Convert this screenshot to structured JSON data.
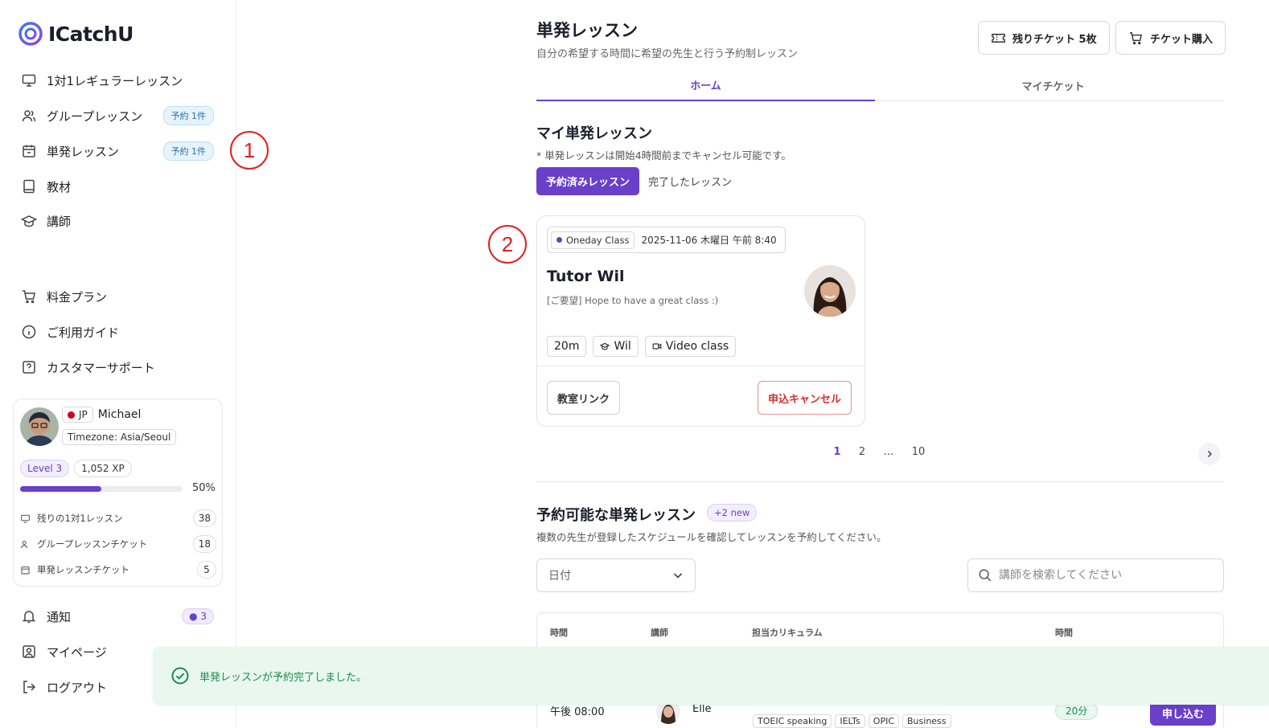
{
  "app": {
    "name": "ICatchU"
  },
  "sidebar": {
    "nav": [
      {
        "label": "1対1レギュラーレッスン",
        "icon": "monitor-icon"
      },
      {
        "label": "グループレッスン",
        "icon": "users-icon",
        "badge": "予約 1件"
      },
      {
        "label": "単発レッスン",
        "icon": "calendar-icon",
        "badge": "予約 1件"
      },
      {
        "label": "教材",
        "icon": "book-icon"
      },
      {
        "label": "講師",
        "icon": "graduation-cap-icon"
      }
    ],
    "nav2": [
      {
        "label": "料金プラン",
        "icon": "cart-icon"
      },
      {
        "label": "ご利用ガイド",
        "icon": "info-icon"
      },
      {
        "label": "カスタマーサポート",
        "icon": "help-icon"
      }
    ],
    "profile": {
      "country": "JP",
      "name": "Michael",
      "timezone": "Timezone: Asia/Seoul",
      "level": "Level 3",
      "xp": "1,052 XP",
      "progress_label": "50%",
      "progress": 0.5,
      "stats": [
        {
          "label": "残りの1対1レッスン",
          "value": "38"
        },
        {
          "label": "グループレッスンチケット",
          "value": "18"
        },
        {
          "label": "単発レッスンチケット",
          "value": "5"
        }
      ]
    },
    "bottom": [
      {
        "label": "通知",
        "icon": "bell-icon",
        "badge": "3"
      },
      {
        "label": "マイページ",
        "icon": "user-icon"
      },
      {
        "label": "ログアウト",
        "icon": "logout-icon"
      }
    ]
  },
  "header": {
    "title": "単発レッスン",
    "subtitle": "自分の希望する時間に希望の先生と行う予約制レッスン",
    "tickets_btn": "残りチケット 5枚",
    "buy_btn": "チケット購入"
  },
  "tabs": [
    {
      "label": "ホーム",
      "active": true
    },
    {
      "label": "マイチケット",
      "active": false
    }
  ],
  "my_lessons": {
    "title": "マイ単発レッスン",
    "note": "* 単発レッスンは開始4時間前までキャンセル可能です。",
    "filter_active": "予約済みレッスン",
    "filter_other": "完了したレッスン",
    "card": {
      "class_type": "Oneday Class",
      "datetime": "2025-11-06 木曜日 午前 8:40",
      "tutor": "Tutor Wil",
      "request": "[ご要望] Hope to have a great class :)",
      "duration": "20m",
      "tutor_tag": "Wil",
      "format": "Video class",
      "room_link": "教室リンク",
      "cancel": "申込キャンセル"
    },
    "pages": [
      "1",
      "2",
      "...",
      "10"
    ],
    "current_page": "1"
  },
  "available": {
    "title": "予約可能な単発レッスン",
    "new_badge": "+2 new",
    "note": "複数の先生が登録したスケジュールを確認してレッスンを予約してください。",
    "date_select": "日付",
    "search_placeholder": "講師を検索してください",
    "columns": [
      "時間",
      "講師",
      "担当カリキュラム",
      "時間"
    ],
    "rows": [
      {
        "time": "午後 08:00",
        "tutor": "Elle",
        "tags": [
          "TOEIC speaking",
          "IELTs",
          "OPIC",
          "Business"
        ],
        "minutes": "20分",
        "apply": "申し込む"
      }
    ]
  },
  "toast": {
    "message": "単発レッスンが予約完了しました。"
  },
  "annotations": [
    "1",
    "2"
  ],
  "colors": {
    "accent": "#6a3fc9",
    "success": "#1c8a4f",
    "danger": "#d6302a",
    "marker": "#e02020"
  }
}
